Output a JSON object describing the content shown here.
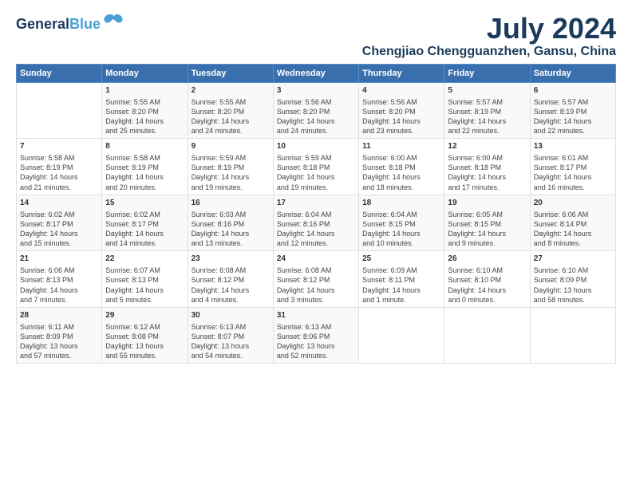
{
  "logo": {
    "line1": "General",
    "line2": "Blue"
  },
  "title": "July 2024",
  "subtitle": "Chengjiao Chengguanzhen, Gansu, China",
  "headers": [
    "Sunday",
    "Monday",
    "Tuesday",
    "Wednesday",
    "Thursday",
    "Friday",
    "Saturday"
  ],
  "weeks": [
    [
      {
        "day": "",
        "content": ""
      },
      {
        "day": "1",
        "content": "Sunrise: 5:55 AM\nSunset: 8:20 PM\nDaylight: 14 hours\nand 25 minutes."
      },
      {
        "day": "2",
        "content": "Sunrise: 5:55 AM\nSunset: 8:20 PM\nDaylight: 14 hours\nand 24 minutes."
      },
      {
        "day": "3",
        "content": "Sunrise: 5:56 AM\nSunset: 8:20 PM\nDaylight: 14 hours\nand 24 minutes."
      },
      {
        "day": "4",
        "content": "Sunrise: 5:56 AM\nSunset: 8:20 PM\nDaylight: 14 hours\nand 23 minutes."
      },
      {
        "day": "5",
        "content": "Sunrise: 5:57 AM\nSunset: 8:19 PM\nDaylight: 14 hours\nand 22 minutes."
      },
      {
        "day": "6",
        "content": "Sunrise: 5:57 AM\nSunset: 8:19 PM\nDaylight: 14 hours\nand 22 minutes."
      }
    ],
    [
      {
        "day": "7",
        "content": "Sunrise: 5:58 AM\nSunset: 8:19 PM\nDaylight: 14 hours\nand 21 minutes."
      },
      {
        "day": "8",
        "content": "Sunrise: 5:58 AM\nSunset: 8:19 PM\nDaylight: 14 hours\nand 20 minutes."
      },
      {
        "day": "9",
        "content": "Sunrise: 5:59 AM\nSunset: 8:19 PM\nDaylight: 14 hours\nand 19 minutes."
      },
      {
        "day": "10",
        "content": "Sunrise: 5:59 AM\nSunset: 8:18 PM\nDaylight: 14 hours\nand 19 minutes."
      },
      {
        "day": "11",
        "content": "Sunrise: 6:00 AM\nSunset: 8:18 PM\nDaylight: 14 hours\nand 18 minutes."
      },
      {
        "day": "12",
        "content": "Sunrise: 6:00 AM\nSunset: 8:18 PM\nDaylight: 14 hours\nand 17 minutes."
      },
      {
        "day": "13",
        "content": "Sunrise: 6:01 AM\nSunset: 8:17 PM\nDaylight: 14 hours\nand 16 minutes."
      }
    ],
    [
      {
        "day": "14",
        "content": "Sunrise: 6:02 AM\nSunset: 8:17 PM\nDaylight: 14 hours\nand 15 minutes."
      },
      {
        "day": "15",
        "content": "Sunrise: 6:02 AM\nSunset: 8:17 PM\nDaylight: 14 hours\nand 14 minutes."
      },
      {
        "day": "16",
        "content": "Sunrise: 6:03 AM\nSunset: 8:16 PM\nDaylight: 14 hours\nand 13 minutes."
      },
      {
        "day": "17",
        "content": "Sunrise: 6:04 AM\nSunset: 8:16 PM\nDaylight: 14 hours\nand 12 minutes."
      },
      {
        "day": "18",
        "content": "Sunrise: 6:04 AM\nSunset: 8:15 PM\nDaylight: 14 hours\nand 10 minutes."
      },
      {
        "day": "19",
        "content": "Sunrise: 6:05 AM\nSunset: 8:15 PM\nDaylight: 14 hours\nand 9 minutes."
      },
      {
        "day": "20",
        "content": "Sunrise: 6:06 AM\nSunset: 8:14 PM\nDaylight: 14 hours\nand 8 minutes."
      }
    ],
    [
      {
        "day": "21",
        "content": "Sunrise: 6:06 AM\nSunset: 8:13 PM\nDaylight: 14 hours\nand 7 minutes."
      },
      {
        "day": "22",
        "content": "Sunrise: 6:07 AM\nSunset: 8:13 PM\nDaylight: 14 hours\nand 5 minutes."
      },
      {
        "day": "23",
        "content": "Sunrise: 6:08 AM\nSunset: 8:12 PM\nDaylight: 14 hours\nand 4 minutes."
      },
      {
        "day": "24",
        "content": "Sunrise: 6:08 AM\nSunset: 8:12 PM\nDaylight: 14 hours\nand 3 minutes."
      },
      {
        "day": "25",
        "content": "Sunrise: 6:09 AM\nSunset: 8:11 PM\nDaylight: 14 hours\nand 1 minute."
      },
      {
        "day": "26",
        "content": "Sunrise: 6:10 AM\nSunset: 8:10 PM\nDaylight: 14 hours\nand 0 minutes."
      },
      {
        "day": "27",
        "content": "Sunrise: 6:10 AM\nSunset: 8:09 PM\nDaylight: 13 hours\nand 58 minutes."
      }
    ],
    [
      {
        "day": "28",
        "content": "Sunrise: 6:11 AM\nSunset: 8:09 PM\nDaylight: 13 hours\nand 57 minutes."
      },
      {
        "day": "29",
        "content": "Sunrise: 6:12 AM\nSunset: 8:08 PM\nDaylight: 13 hours\nand 55 minutes."
      },
      {
        "day": "30",
        "content": "Sunrise: 6:13 AM\nSunset: 8:07 PM\nDaylight: 13 hours\nand 54 minutes."
      },
      {
        "day": "31",
        "content": "Sunrise: 6:13 AM\nSunset: 8:06 PM\nDaylight: 13 hours\nand 52 minutes."
      },
      {
        "day": "",
        "content": ""
      },
      {
        "day": "",
        "content": ""
      },
      {
        "day": "",
        "content": ""
      }
    ]
  ]
}
